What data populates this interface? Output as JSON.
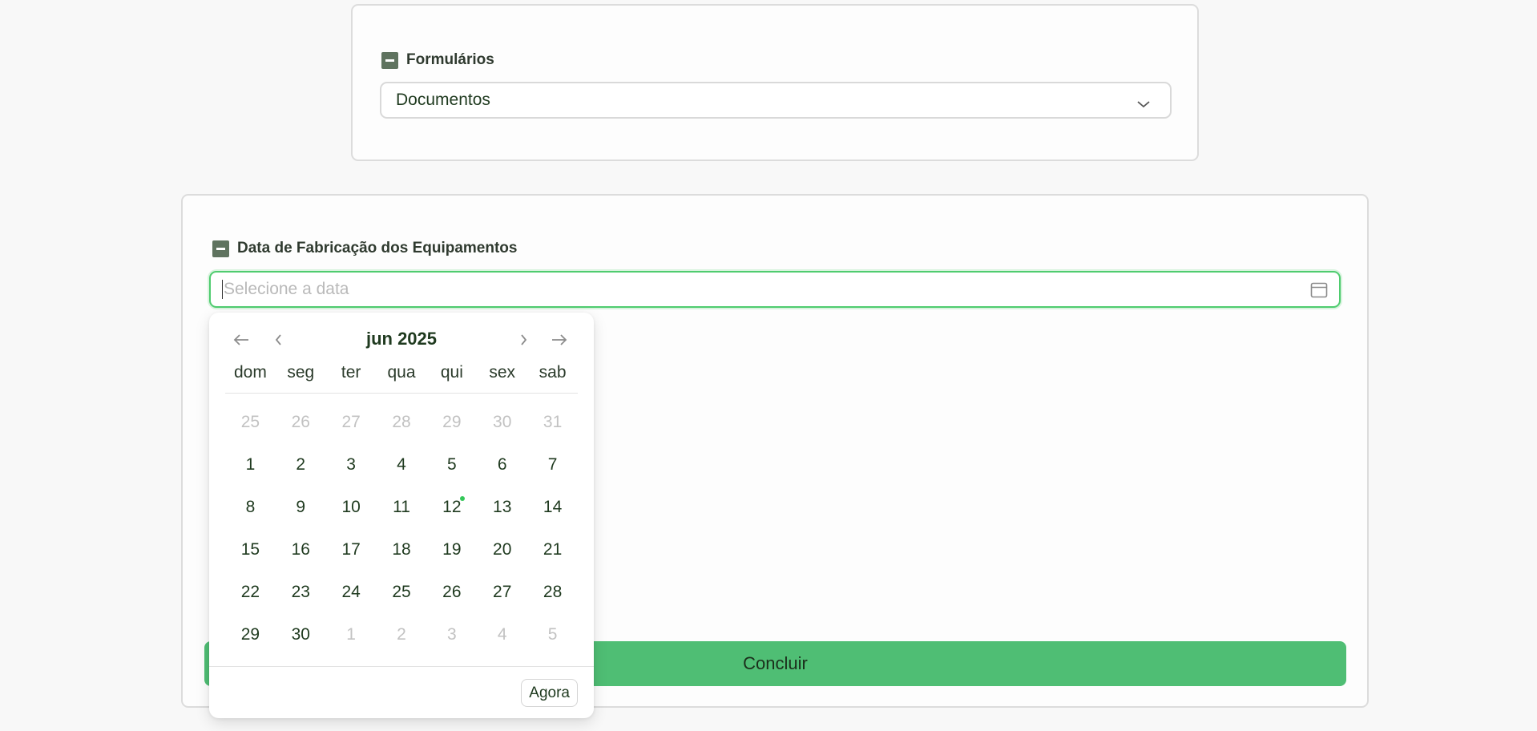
{
  "forms_card": {
    "label": "Formulários",
    "select_value": "Documentos"
  },
  "date_card": {
    "label": "Data de Fabricação dos Equipamentos",
    "placeholder": "Selecione a data",
    "submit_label": "Concluir"
  },
  "datepicker": {
    "month_title": "jun 2025",
    "weekdays": [
      "dom",
      "seg",
      "ter",
      "qua",
      "qui",
      "sex",
      "sab"
    ],
    "today": "12",
    "days": [
      "25",
      "26",
      "27",
      "28",
      "29",
      "30",
      "31",
      "1",
      "2",
      "3",
      "4",
      "5",
      "6",
      "7",
      "8",
      "9",
      "10",
      "11",
      "12",
      "13",
      "14",
      "15",
      "16",
      "17",
      "18",
      "19",
      "20",
      "21",
      "22",
      "23",
      "24",
      "25",
      "26",
      "27",
      "28",
      "29",
      "30",
      "1",
      "2",
      "3",
      "4",
      "5"
    ],
    "now_label": "Agora"
  },
  "colors": {
    "accent": "#4fbe74",
    "focus_border": "#4fcc6f",
    "today_dot": "#34c759",
    "label_box": "#5f735f"
  },
  "icons": {
    "select_chevron": "chevron-down-icon",
    "date_field": "calendar-icon",
    "prev_year": "arrow-left-icon",
    "prev_month": "chevron-left-icon",
    "next_month": "chevron-right-icon",
    "next_year": "arrow-right-icon"
  }
}
